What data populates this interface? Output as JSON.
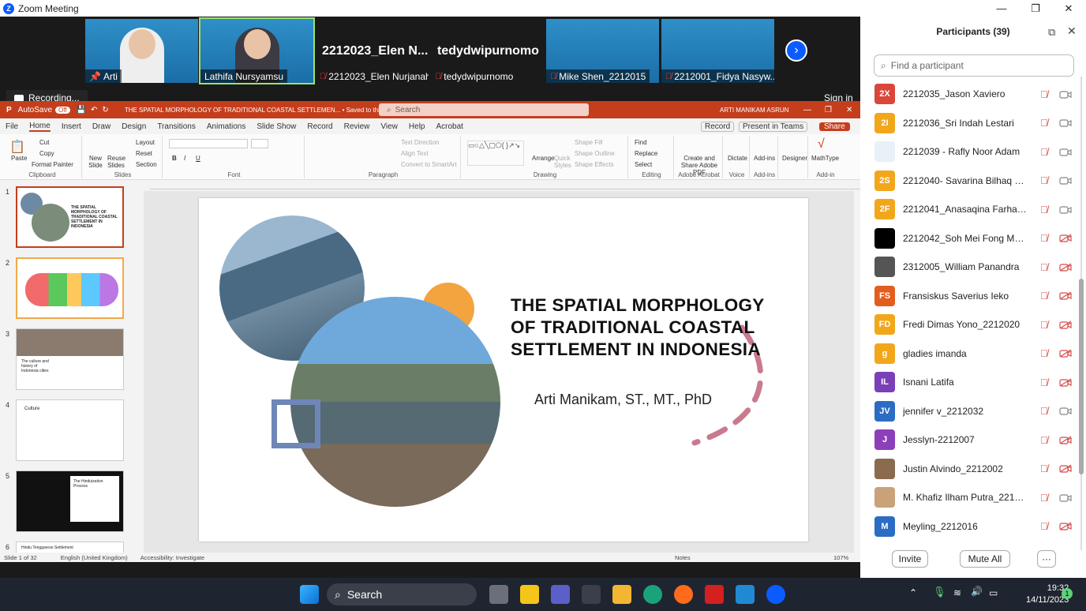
{
  "window": {
    "title": "Zoom Meeting",
    "minimize": "—",
    "maximize": "❐",
    "close": "✕"
  },
  "gallery": {
    "tiles": [
      {
        "name": "Arti",
        "type": "video"
      },
      {
        "name": "Lathifa Nursyamsu",
        "type": "video"
      },
      {
        "name": "2212023_Elen Nurjanah",
        "display": "2212023_Elen N...",
        "type": "name"
      },
      {
        "name": "tedydwipurnomo",
        "display": "tedydwipurnomo",
        "type": "name"
      },
      {
        "name": "Mike Shen_2212015",
        "type": "video"
      },
      {
        "name": "2212001_Fidya Nasyw...",
        "type": "video"
      }
    ]
  },
  "recording": {
    "label": "Recording..."
  },
  "signin": "Sign in",
  "powerpoint": {
    "autosave": "AutoSave",
    "autosave_state": "Off",
    "doc_title": "THE SPATIAL MORPHOLOGY OF TRADITIONAL COASTAL SETTLEMEN... • Saved to this PC",
    "search_placeholder": "Search",
    "user": "ARTI MANIKAM ASRUN",
    "tabs": [
      "File",
      "Home",
      "Insert",
      "Draw",
      "Design",
      "Transitions",
      "Animations",
      "Slide Show",
      "Record",
      "Review",
      "View",
      "Help",
      "Acrobat"
    ],
    "active_tab": "Home",
    "record_btn": "Record",
    "present_btn": "Present in Teams",
    "share_btn": "Share",
    "ribbon": {
      "clipboard": {
        "label": "Clipboard",
        "paste": "Paste",
        "cut": "Cut",
        "copy": "Copy",
        "format_painter": "Format Painter"
      },
      "slides": {
        "label": "Slides",
        "new_slide": "New Slide",
        "reuse": "Reuse Slides",
        "layout": "Layout",
        "reset": "Reset",
        "section": "Section"
      },
      "font": {
        "label": "Font"
      },
      "paragraph": {
        "label": "Paragraph",
        "text_direction": "Text Direction",
        "align_text": "Align Text",
        "smartart": "Convert to SmartArt"
      },
      "drawing": {
        "label": "Drawing",
        "arrange": "Arrange",
        "quick_styles": "Quick Styles",
        "shape_fill": "Shape Fill",
        "shape_outline": "Shape Outline",
        "shape_effects": "Shape Effects"
      },
      "editing": {
        "label": "Editing",
        "find": "Find",
        "replace": "Replace",
        "select": "Select"
      },
      "adobe": {
        "label": "Adobe Acrobat",
        "create": "Create and Share Adobe PDF"
      },
      "voice": {
        "label": "Voice",
        "dictate": "Dictate"
      },
      "addins": {
        "label": "Add-ins",
        "addins": "Add-ins"
      },
      "designer": "Designer",
      "mathtype": {
        "label": "Add-in",
        "name": "MathType"
      }
    },
    "slide": {
      "title": "THE SPATIAL MORPHOLOGY OF TRADITIONAL COASTAL SETTLEMENT IN INDONESIA",
      "author": "Arti Manikam, ST., MT., PhD"
    },
    "thumbs": [
      {
        "num": "1",
        "text": "THE SPATIAL MORPHOLOGY OF TRADITIONAL COASTAL SETTLEMENT IN INDONESIA"
      },
      {
        "num": "2",
        "text": ""
      },
      {
        "num": "3",
        "text": "The culture and history of Indonesia cities"
      },
      {
        "num": "4",
        "text": "Culture"
      },
      {
        "num": "5",
        "text": "The Hinduization Process"
      },
      {
        "num": "6",
        "text": "Hindu Tenggarese Settlement"
      }
    ],
    "status": {
      "slide": "Slide 1 of 32",
      "language": "English (United Kingdom)",
      "accessibility": "Accessibility: Investigate",
      "notes": "Notes",
      "zoom": "107%"
    }
  },
  "participants": {
    "title": "Participants (39)",
    "search_placeholder": "Find a participant",
    "list": [
      {
        "initials": "2X",
        "color": "#d9473b",
        "name": "2212035_Jason Xaviero",
        "cam": "on"
      },
      {
        "initials": "2I",
        "color": "#f2a71b",
        "name": "2212036_Sri Indah Lestari",
        "cam": "on"
      },
      {
        "initials": "",
        "color": "#e8f0f8",
        "name": "2212039 - Rafly Noor Adam",
        "cam": "on",
        "avatar": "cartoon"
      },
      {
        "initials": "2S",
        "color": "#f2a71b",
        "name": "2212040- Savarina Bilhaq Helmi",
        "cam": "on"
      },
      {
        "initials": "2F",
        "color": "#f2a71b",
        "name": "2212041_Anasaqina Farhana Pu...",
        "cam": "on"
      },
      {
        "initials": "",
        "color": "#000000",
        "name": "2212042_Soh Mei Fong Merlin",
        "cam": "off"
      },
      {
        "initials": "",
        "color": "#555555",
        "name": "2312005_William Panandra",
        "cam": "off",
        "avatar": "photo"
      },
      {
        "initials": "FS",
        "color": "#e35d1d",
        "name": "Fransiskus Saverius Ieko",
        "cam": "off"
      },
      {
        "initials": "FD",
        "color": "#f2a71b",
        "name": "Fredi Dimas Yono_2212020",
        "cam": "off"
      },
      {
        "initials": "g",
        "color": "#f2a71b",
        "name": "gladies imanda",
        "cam": "off"
      },
      {
        "initials": "IL",
        "color": "#7b3fb8",
        "name": "Isnani Latifa",
        "cam": "off"
      },
      {
        "initials": "JV",
        "color": "#2b6cc4",
        "name": "jennifer v_2212032",
        "cam": "on"
      },
      {
        "initials": "J",
        "color": "#8c3fb8",
        "name": "Jesslyn-2212007",
        "cam": "off"
      },
      {
        "initials": "",
        "color": "#8a6b50",
        "name": "Justin Alvindo_2212002",
        "cam": "off",
        "avatar": "photo"
      },
      {
        "initials": "",
        "color": "#c9a27a",
        "name": "M. Khafiz Ilham Putra_2212003",
        "cam": "on",
        "avatar": "photo"
      },
      {
        "initials": "M",
        "color": "#2b6cc4",
        "name": "Meyling_2212016",
        "cam": "off"
      }
    ],
    "invite": "Invite",
    "mute_all": "Mute All",
    "more": "···"
  },
  "taskbar": {
    "search": "Search",
    "time": "19:32",
    "date": "14/11/2023",
    "notif": "1"
  }
}
